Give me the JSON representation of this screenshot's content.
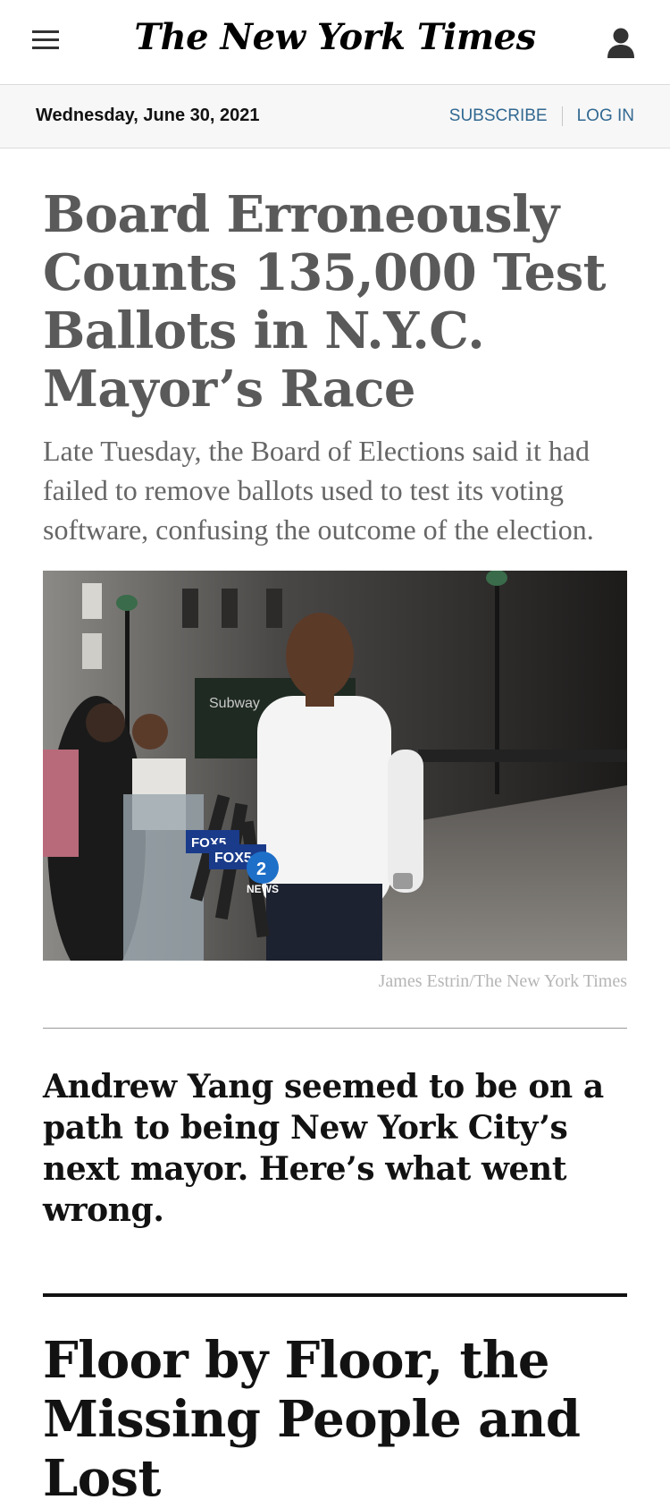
{
  "header": {
    "logo_text": "The New York Times",
    "menu_icon": "hamburger-menu-icon",
    "account_icon": "user-account-icon"
  },
  "datebar": {
    "date": "Wednesday, June 30, 2021",
    "subscribe_label": "SUBSCRIBE",
    "login_label": "LOG IN"
  },
  "article": {
    "headline": "Board Erroneously Counts 135,000 Test Ballots in N.Y.C. Mayor’s Race",
    "summary": "Late Tuesday, the Board of Elections said it had failed to remove ballots used to test its voting software, confusing the outcome of the election.",
    "photo_credit": "James Estrin/The New York Times",
    "photo_signs": {
      "subway": "Subway",
      "fox5_a": "FOX5",
      "fox5_b": "FOX5",
      "cbs2": "2",
      "cbs2_news": "NEWS"
    }
  },
  "related": {
    "headline": "Andrew Yang seemed to be on a path to being New York City’s next mayor. Here’s what went wrong."
  },
  "next_story": {
    "headline": "Floor by Floor, the Missing People and Lost"
  },
  "colors": {
    "link_blue": "#326891",
    "headline_gray": "#5a5a5a",
    "text_dark": "#121212"
  }
}
